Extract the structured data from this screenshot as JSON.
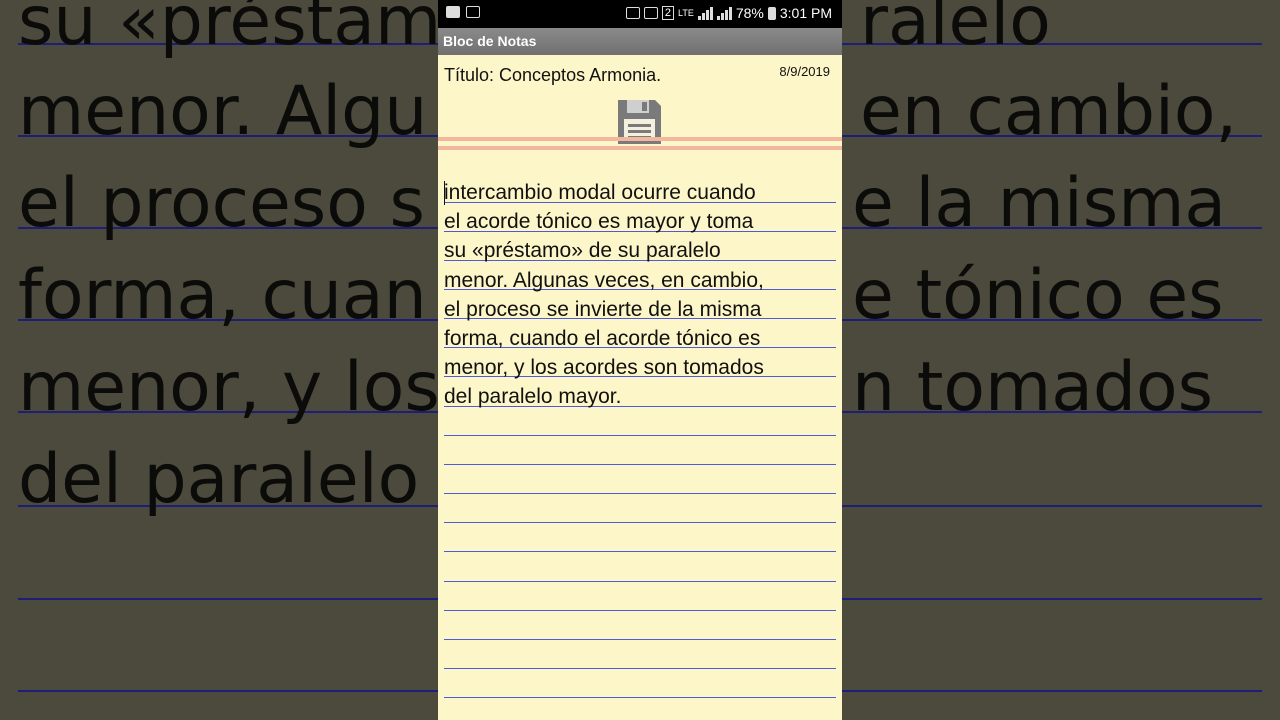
{
  "status_bar": {
    "battery": "78%",
    "time": "3:01 PM",
    "sim_slot": "2",
    "network": "LTE"
  },
  "app": {
    "title": "Bloc de Notas"
  },
  "note": {
    "title_label": "Título: Conceptos Armonia.",
    "date": "8/9/2019",
    "save_icon": "floppy-disk-icon",
    "body": "intercambio modal ocurre cuando\nel acorde tónico es mayor y toma\nsu «préstamo» de su paralelo\nmenor. Algunas veces, en cambio,\nel proceso se invierte de la misma\nforma, cuando el acorde tónico es\nmenor, y los acordes son tomados\ndel paralelo mayor."
  },
  "background": {
    "lines": [
      "su «préstamo",
      "menor. Algu",
      "el proceso s",
      "forma, cuan",
      "menor, y los",
      "del paralelo",
      "ralelo",
      "en cambio,",
      "e la misma",
      "e tónico es",
      "n tomados"
    ]
  },
  "colors": {
    "paper": "#fdf6c8",
    "rule_line": "#4d5bd6",
    "header_line": "#f3b7a0",
    "titlebar": "#7c7c7c"
  }
}
